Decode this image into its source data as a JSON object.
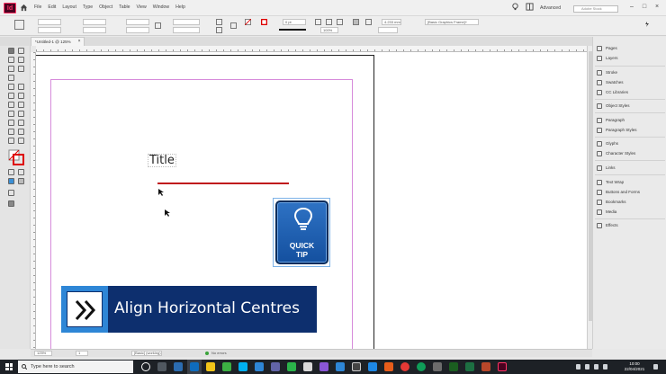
{
  "app": {
    "logo": "Id",
    "workspace": "Advanced",
    "search_placeholder": "Adobe Stock"
  },
  "menu": [
    "File",
    "Edit",
    "Layout",
    "Type",
    "Object",
    "Table",
    "View",
    "Window",
    "Help"
  ],
  "control": {
    "stroke_weight": "0 pt",
    "opacity": "100%",
    "width_value": "4.233 mm",
    "object_style": "[Basic Graphics Frame]+"
  },
  "document": {
    "tab_label": "*Untitled-1 @ 125%",
    "close_glyph": "×"
  },
  "canvas": {
    "title_text": "Title",
    "quick_tip": [
      "QUICK",
      "TIP"
    ],
    "banner_text": "Align Horizontal Centres",
    "colors": {
      "banner_dark": "#0d2f6e",
      "banner_light": "#2e86d6",
      "red_line": "#c0161c",
      "margin_guide": "#d68bdb"
    }
  },
  "panels": [
    {
      "label": "Pages",
      "icon": "pages-icon"
    },
    {
      "label": "Layers",
      "icon": "layers-icon"
    },
    {
      "label": "Stroke",
      "icon": "stroke-icon"
    },
    {
      "label": "Swatches",
      "icon": "swatches-icon"
    },
    {
      "label": "CC Libraries",
      "icon": "cc-libraries-icon"
    },
    {
      "label": "Object Styles",
      "icon": "object-styles-icon"
    },
    {
      "label": "Paragraph",
      "icon": "paragraph-icon"
    },
    {
      "label": "Paragraph Styles",
      "icon": "paragraph-styles-icon"
    },
    {
      "label": "Glyphs",
      "icon": "glyphs-icon"
    },
    {
      "label": "Character Styles",
      "icon": "character-styles-icon"
    },
    {
      "label": "Links",
      "icon": "links-icon"
    },
    {
      "label": "Text Wrap",
      "icon": "text-wrap-icon"
    },
    {
      "label": "Buttons and Forms",
      "icon": "buttons-forms-icon"
    },
    {
      "label": "Bookmarks",
      "icon": "bookmarks-icon"
    },
    {
      "label": "Media",
      "icon": "media-icon"
    },
    {
      "label": "Effects",
      "icon": "effects-icon"
    }
  ],
  "status": {
    "zoom": "125%",
    "page": "1",
    "style": "[Basic] (working)",
    "preflight": "No errors"
  },
  "taskbar": {
    "search_placeholder": "Type here to search",
    "time": "10:00",
    "date": "22/04/2021"
  }
}
